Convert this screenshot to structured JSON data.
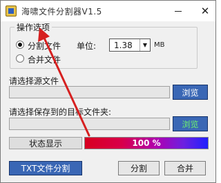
{
  "window": {
    "title": "海啸文件分割器V1.5",
    "minimize_glyph": "—",
    "close_glyph": "✕"
  },
  "options_group": {
    "label": "操作选项",
    "split_label": "分割文件",
    "merge_label": "合并文件",
    "selected": "split",
    "unit_label": "单位:",
    "unit_value": "1.38",
    "unit_suffix": "MB"
  },
  "source": {
    "label": "请选择源文件",
    "value": "",
    "browse_label": "浏览"
  },
  "destination": {
    "label": "请选择保存到的目标文件夹:",
    "value": "",
    "browse_label": "浏览"
  },
  "status": {
    "label": "状态显示",
    "progress_percent": 100,
    "progress_text": "100 %"
  },
  "buttons": {
    "txt_split": "TXT文件分割",
    "split": "分割",
    "merge": "合并"
  },
  "colors": {
    "button_blue": "#3a67b5",
    "annotation_arrow": "#d62020",
    "green_text": "#6df26d"
  }
}
